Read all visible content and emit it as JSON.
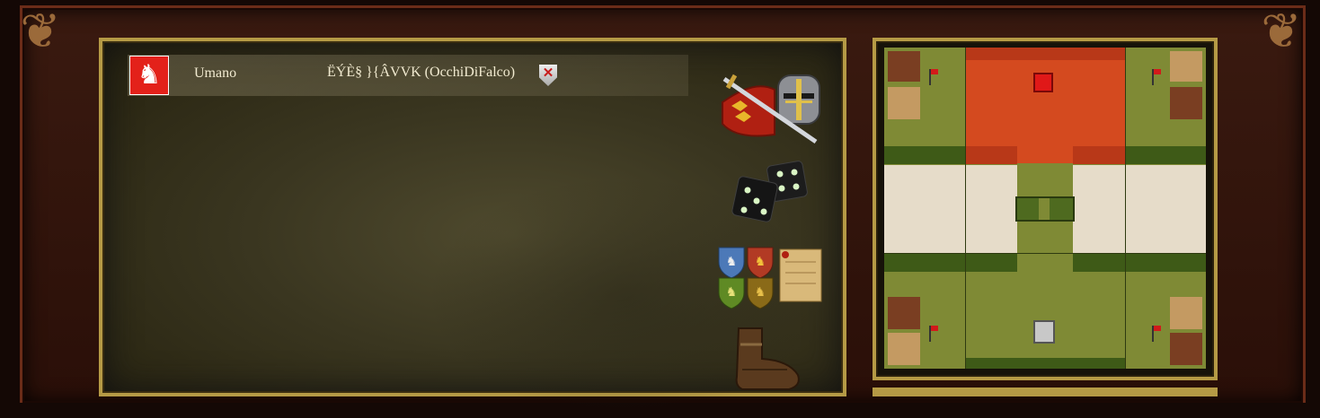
{
  "player": {
    "type": "Umano",
    "name": "ËÝÈ§ }{ÂVVK (OcchiDiFalco)",
    "flag_color": "#e3211a"
  },
  "icons": {
    "player_flag": "lion-rampant-icon",
    "kick": "kick-player-icon",
    "army": "sword-helmet-icon",
    "random": "dice-icon",
    "teams": "team-shields-icon",
    "scroll": "scroll-icon",
    "boot": "boot-icon"
  },
  "map": {
    "base_color": "#7f8a35",
    "player_area_color": "#d44a1f",
    "road_color": "#e6dcc9",
    "dark_field_color": "#3e5a17"
  }
}
